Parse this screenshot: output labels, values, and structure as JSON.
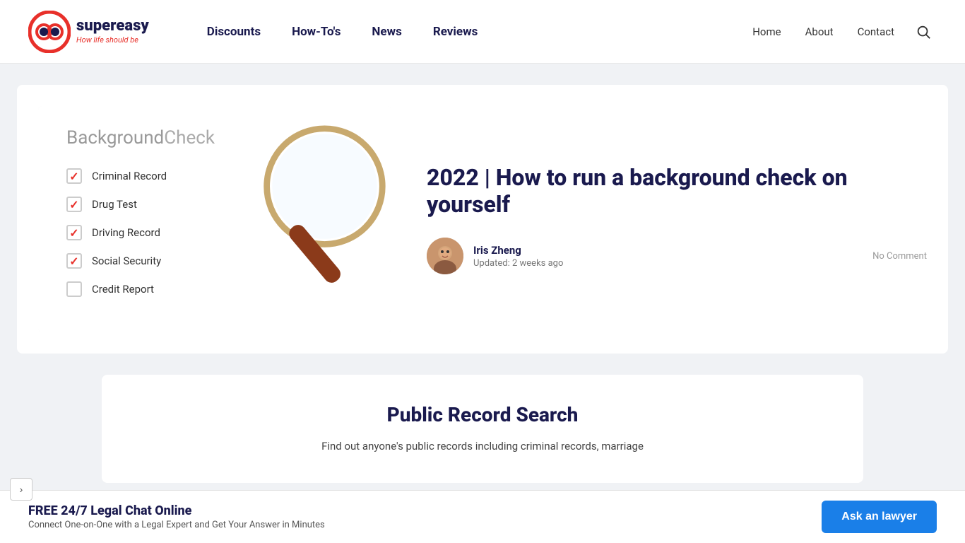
{
  "header": {
    "logo": {
      "super": "super",
      "easy": "easy",
      "tagline_start": "How life ",
      "tagline_highlight": "should",
      "tagline_end": " be"
    },
    "nav": {
      "items": [
        {
          "label": "Discounts",
          "href": "#"
        },
        {
          "label": "How-To's",
          "href": "#"
        },
        {
          "label": "News",
          "href": "#"
        },
        {
          "label": "Reviews",
          "href": "#"
        }
      ]
    },
    "right_nav": {
      "items": [
        {
          "label": "Home",
          "href": "#"
        },
        {
          "label": "About",
          "href": "#"
        },
        {
          "label": "Contact",
          "href": "#"
        }
      ]
    }
  },
  "article": {
    "image": {
      "title_part1": "Background",
      "title_part2": "Check",
      "checklist": [
        {
          "label": "Criminal Record",
          "checked": true
        },
        {
          "label": "Drug Test",
          "checked": true
        },
        {
          "label": "Driving Record",
          "checked": true
        },
        {
          "label": "Social Security",
          "checked": true
        },
        {
          "label": "Credit Report",
          "checked": false
        }
      ]
    },
    "title": "2022 | How to run a background check on yourself",
    "author": {
      "name": "Iris Zheng",
      "updated": "Updated: 2 weeks ago"
    },
    "no_comment": "No Comment"
  },
  "public_record": {
    "title": "Public Record Search",
    "description": "Find out anyone's public records including criminal records, marriage"
  },
  "banner": {
    "title": "FREE 24/7 Legal Chat Online",
    "description": "Connect One-on-One with a Legal Expert and Get Your Answer in Minutes",
    "button_label": "Ask an lawyer"
  }
}
